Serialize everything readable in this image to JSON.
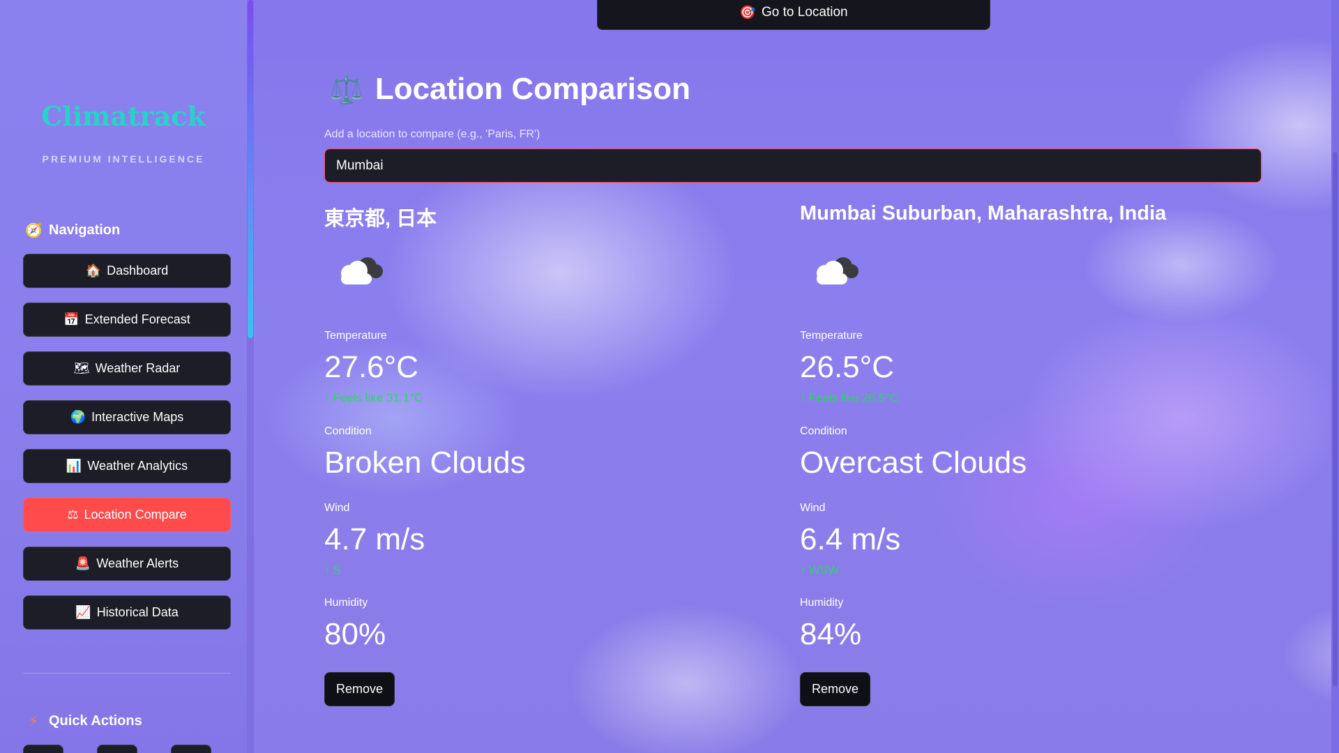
{
  "sidebar": {
    "brand": "Climatrack",
    "brand_sub": "PREMIUM INTELLIGENCE",
    "navigation_title": "Navigation",
    "navigation_icon": "compass-icon",
    "items": [
      {
        "label": "Dashboard",
        "icon": "house-icon",
        "glyph": "🏠",
        "active": false
      },
      {
        "label": "Extended Forecast",
        "icon": "calendar-icon",
        "glyph": "📅",
        "active": false
      },
      {
        "label": "Weather Radar",
        "icon": "map-icon",
        "glyph": "🗺",
        "active": false
      },
      {
        "label": "Interactive Maps",
        "icon": "globe-icon",
        "glyph": "🌍",
        "active": false
      },
      {
        "label": "Weather Analytics",
        "icon": "bar-chart-icon",
        "glyph": "📊",
        "active": false
      },
      {
        "label": "Location Compare",
        "icon": "scales-icon",
        "glyph": "⚖",
        "active": true
      },
      {
        "label": "Weather Alerts",
        "icon": "siren-icon",
        "glyph": "🚨",
        "active": false
      },
      {
        "label": "Historical Data",
        "icon": "trend-chart-icon",
        "glyph": "📈",
        "active": false
      }
    ],
    "quick_actions_title": "Quick Actions",
    "quick_actions_icon": "lightning-icon"
  },
  "header": {
    "goto_label": "Go to Location",
    "goto_icon": "target-icon"
  },
  "main": {
    "title": "Location Comparison",
    "title_icon": "scales-icon",
    "input_label": "Add a location to compare (e.g., 'Paris, FR')",
    "input_value": "Mumbai",
    "locations": [
      {
        "name": "東京都, 日本",
        "icon": "cloud-icon",
        "temperature_label": "Temperature",
        "temperature": "27.6°C",
        "feels_like": "Feels like 31.1°C",
        "condition_label": "Condition",
        "condition": "Broken Clouds",
        "wind_label": "Wind",
        "wind": "4.7 m/s",
        "wind_dir": "S",
        "humidity_label": "Humidity",
        "humidity": "80%",
        "remove_label": "Remove"
      },
      {
        "name": "Mumbai Suburban, Maharashtra, India",
        "icon": "cloud-icon",
        "temperature_label": "Temperature",
        "temperature": "26.5°C",
        "feels_like": "Feels like 26.5°C",
        "condition_label": "Condition",
        "condition": "Overcast Clouds",
        "wind_label": "Wind",
        "wind": "6.4 m/s",
        "wind_dir": "WSW",
        "humidity_label": "Humidity",
        "humidity": "84%",
        "remove_label": "Remove"
      }
    ]
  },
  "colors": {
    "accent": "#ff4b4b",
    "brand": "#27d3c7",
    "delta_positive": "#2fd36a",
    "button_dark": "#1c1d26"
  }
}
